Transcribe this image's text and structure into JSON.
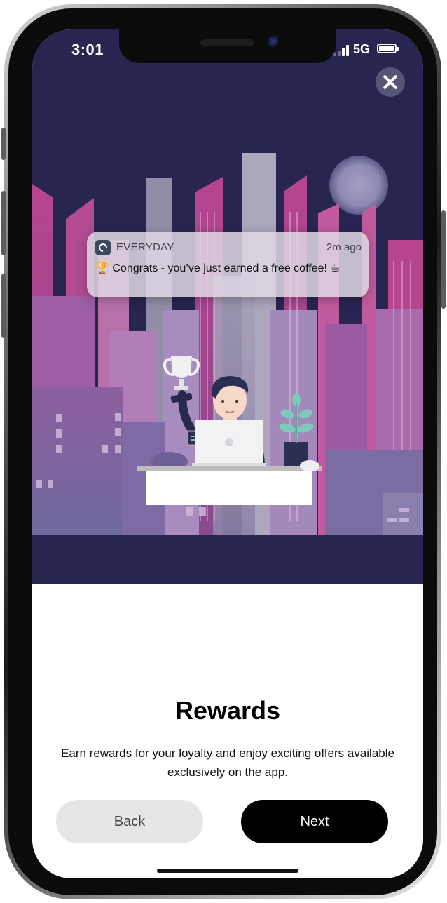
{
  "status_bar": {
    "time": "3:01",
    "network": "5G",
    "signal_icon": "signal-bars-icon",
    "battery_icon": "battery-full-icon"
  },
  "close_icon": "close-icon",
  "notification": {
    "app_icon": "everyday-app-icon",
    "app_name": "EVERYDAY",
    "time": "2m ago",
    "message": "🏆 Congrats - you’ve just earned a free coffee! ☕"
  },
  "onboarding": {
    "title": "Rewards",
    "description": "Earn rewards for your loyalty and enjoy exciting offers available exclusively on the app."
  },
  "buttons": {
    "back": "Back",
    "next": "Next"
  },
  "colors": {
    "hero_background": "#282651",
    "primary_button": "#000000",
    "secondary_button": "#e6e6e6"
  }
}
